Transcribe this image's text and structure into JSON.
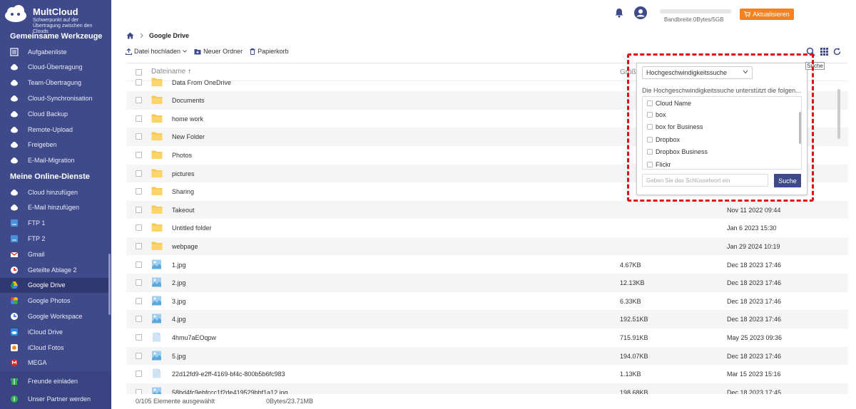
{
  "app": {
    "brand": "MultCloud",
    "tagline": "Schwerpunkt auf der Übertragung zwischen den Clouds"
  },
  "sidebar": {
    "section1": "Gemeinsame Werkzeuge",
    "tools": [
      {
        "label": "Aufgabenliste",
        "icon": "task-list-icon"
      },
      {
        "label": "Cloud-Übertragung",
        "icon": "cloud-transfer-icon"
      },
      {
        "label": "Team-Übertragung",
        "icon": "team-transfer-icon"
      },
      {
        "label": "Cloud-Synchronisation",
        "icon": "cloud-sync-icon"
      },
      {
        "label": "Cloud Backup",
        "icon": "cloud-backup-icon"
      },
      {
        "label": "Remote-Upload",
        "icon": "remote-upload-icon"
      },
      {
        "label": "Freigeben",
        "icon": "share-icon"
      },
      {
        "label": "E-Mail-Migration",
        "icon": "email-migration-icon"
      }
    ],
    "section2": "Meine Online-Dienste",
    "services": [
      {
        "label": "Cloud hinzufügen",
        "icon": "add-cloud-icon"
      },
      {
        "label": "E-Mail hinzufügen",
        "icon": "add-email-icon"
      },
      {
        "label": "FTP 1",
        "icon": "ftp-icon"
      },
      {
        "label": "FTP 2",
        "icon": "ftp-icon"
      },
      {
        "label": "Gmail",
        "icon": "gmail-icon"
      },
      {
        "label": "Geteilte Ablage 2",
        "icon": "shared-drive-icon"
      },
      {
        "label": "Google Drive",
        "icon": "google-drive-icon"
      },
      {
        "label": "Google Photos",
        "icon": "google-photos-icon"
      },
      {
        "label": "Google Workspace",
        "icon": "google-workspace-icon"
      },
      {
        "label": "iCloud Drive",
        "icon": "icloud-drive-icon"
      },
      {
        "label": "iCloud Fotos",
        "icon": "icloud-photos-icon"
      },
      {
        "label": "MEGA",
        "icon": "mega-icon"
      }
    ],
    "bottom": [
      {
        "label": "Freunde einladen",
        "icon": "invite-icon"
      },
      {
        "label": "Unser Partner werden",
        "icon": "partner-icon"
      }
    ]
  },
  "header": {
    "bandwidth": "Bandbreite:0Bytes/5GB",
    "upgrade": "Aktualisieren"
  },
  "breadcrumb": {
    "current": "Google Drive"
  },
  "toolbar": {
    "upload": "Datei hochladen",
    "new_folder": "Neuer Ordner",
    "trash": "Papierkorb"
  },
  "table": {
    "col_name": "Dateiname",
    "col_size": "Größe",
    "rows": [
      {
        "name": "Data From OneDrive",
        "type": "folder",
        "size": "",
        "date": ""
      },
      {
        "name": "Documents",
        "type": "folder",
        "size": "",
        "date": ""
      },
      {
        "name": "home work",
        "type": "folder",
        "size": "",
        "date": ""
      },
      {
        "name": "New Folder",
        "type": "folder",
        "size": "",
        "date": ""
      },
      {
        "name": "Photos",
        "type": "folder",
        "size": "",
        "date": ""
      },
      {
        "name": "pictures",
        "type": "folder",
        "size": "",
        "date": ""
      },
      {
        "name": "Sharing",
        "type": "folder",
        "size": "",
        "date": ""
      },
      {
        "name": "Takeout",
        "type": "folder",
        "size": "",
        "date": "Nov 11 2022 09:44"
      },
      {
        "name": "Untitled folder",
        "type": "folder",
        "size": "",
        "date": "Jan 6 2023 15:30"
      },
      {
        "name": "webpage",
        "type": "folder",
        "size": "",
        "date": "Jan 29 2024 10:19"
      },
      {
        "name": "1.jpg",
        "type": "image",
        "size": "4.67KB",
        "date": "Dec 18 2023 17:46"
      },
      {
        "name": "2.jpg",
        "type": "image",
        "size": "12.13KB",
        "date": "Dec 18 2023 17:46"
      },
      {
        "name": "3.jpg",
        "type": "image",
        "size": "6.33KB",
        "date": "Dec 18 2023 17:46"
      },
      {
        "name": "4.jpg",
        "type": "image",
        "size": "192.51KB",
        "date": "Dec 18 2023 17:46"
      },
      {
        "name": "4hmu7aEOqpw",
        "type": "file",
        "size": "715.91KB",
        "date": "May 25 2023 09:36"
      },
      {
        "name": "5.jpg",
        "type": "image",
        "size": "194.07KB",
        "date": "Dec 18 2023 17:46"
      },
      {
        "name": "22d12fd9-e2ff-4169-bf4c-800b5b6fc983",
        "type": "file",
        "size": "1.13KB",
        "date": "Mar 15 2023 15:16"
      },
      {
        "name": "58bd4fc9ebfccc1f2de419529bbf1a12.jpg",
        "type": "image",
        "size": "198.68KB",
        "date": "Dec 18 2023 17:45"
      }
    ]
  },
  "footer": {
    "selected": "0/105 Elemente ausgewählt",
    "size": "0Bytes/23.71MB"
  },
  "search_popup": {
    "tooltip": "Suche",
    "mode": "Hochgeschwindigkeitssuche",
    "description": "Die Hochgeschwindigkeitssuche unterstützt die folgen...",
    "header_option": "Cloud Name",
    "clouds": [
      "box",
      "box for Business",
      "Dropbox",
      "Dropbox Business",
      "Flickr"
    ],
    "placeholder": "Geben Sie das Schlüsselwort ein",
    "button": "Suche"
  },
  "colors": {
    "sidebar": "#3f4a8a",
    "accent": "#f5821f",
    "highlight": "#e0101a"
  }
}
